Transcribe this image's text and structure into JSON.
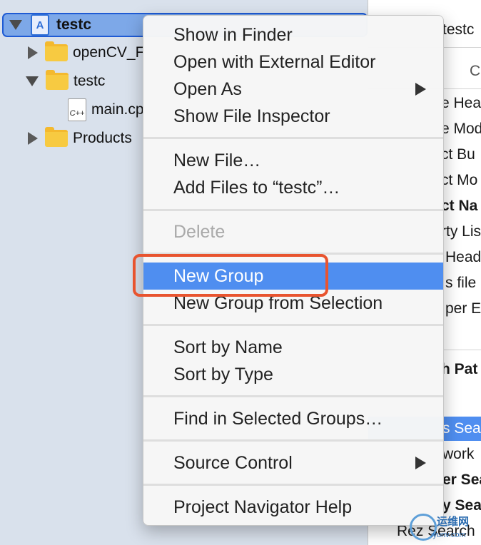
{
  "navigator": {
    "rows": [
      {
        "label": "testc"
      },
      {
        "label": "openCV_F"
      },
      {
        "label": "testc"
      },
      {
        "label": "main.cp"
      },
      {
        "label": "Products"
      }
    ],
    "file_badge": "C++"
  },
  "inspector": {
    "lines": [
      "testc",
      "Cu",
      "e Hea",
      "e Mod",
      "ct Bu",
      "ct Mo",
      "ct Na",
      "rty Lis",
      "Head",
      "s file",
      "per Ex",
      "h Pat",
      "s Sea",
      "work",
      "er Sea",
      "y Sea",
      "Rez Search"
    ]
  },
  "menu": {
    "items": [
      {
        "label": "Show in Finder"
      },
      {
        "label": "Open with External Editor"
      },
      {
        "label": "Open As"
      },
      {
        "label": "Show File Inspector"
      },
      {
        "label": "New File…"
      },
      {
        "label": "Add Files to “testc”…"
      },
      {
        "label": "Delete"
      },
      {
        "label": "New Group"
      },
      {
        "label": "New Group from Selection"
      },
      {
        "label": "Sort by Name"
      },
      {
        "label": "Sort by Type"
      },
      {
        "label": "Find in Selected Groups…"
      },
      {
        "label": "Source Control"
      },
      {
        "label": "Project Navigator Help"
      }
    ]
  },
  "watermark": {
    "cn": "运维网",
    "url": "iyunv.com"
  },
  "colors": {
    "highlight": "#4f8ef0",
    "annotation": "#e8542f",
    "navigator_bg": "#d9e1ec"
  }
}
